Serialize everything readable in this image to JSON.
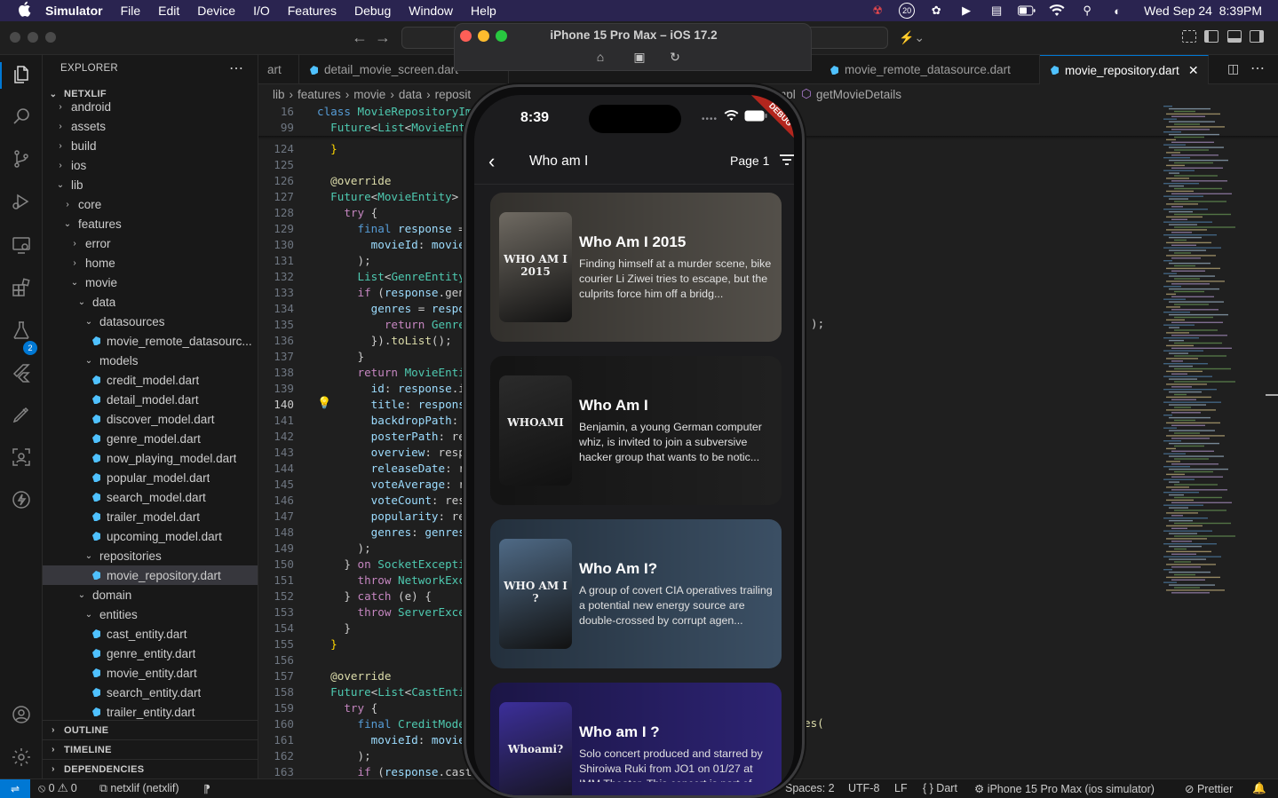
{
  "menubar": {
    "app": "Simulator",
    "items": [
      "File",
      "Edit",
      "Device",
      "I/O",
      "Features",
      "Debug",
      "Window",
      "Help"
    ],
    "status_badge": "20",
    "datetime": "Wed Sep 24  8:39PM"
  },
  "simulator": {
    "title": "iPhone 15 Pro Max – iOS 17.2",
    "time": "8:39",
    "debug_label": "DEBUG",
    "appbar_title": "Who am I",
    "page_label": "Page 1",
    "movies": [
      {
        "title": "Who Am I 2015",
        "overview": "Finding himself at a murder scene, bike courier Li Ziwei tries to escape, but the culprits force him off a bridg...",
        "poster_text": "WHO AM I 2015",
        "accent": "#6f6a62"
      },
      {
        "title": "Who Am I",
        "overview": "Benjamin, a young German computer whiz, is invited to join a subversive hacker group that wants to be notic...",
        "poster_text": "WHOAMI",
        "accent": "#2b2b2b"
      },
      {
        "title": "Who Am I?",
        "overview": "A group of covert CIA operatives trailing a potential new energy source are double-crossed by corrupt agen...",
        "poster_text": "WHO AM I ?",
        "accent": "#4f6a86"
      },
      {
        "title": "Who am I ?",
        "overview": "Solo concert produced and starred by Shiroiwa Ruki from JO1 on 01/27 at IMM Theater. This concert is part of",
        "poster_text": "Whoami?",
        "accent": "#3c2f9a"
      }
    ]
  },
  "explorer": {
    "header": "EXPLORER",
    "root": "NETXLIF",
    "tree": [
      {
        "label": "android",
        "indent": 1,
        "kind": "folder-closed"
      },
      {
        "label": "assets",
        "indent": 1,
        "kind": "folder-closed"
      },
      {
        "label": "build",
        "indent": 1,
        "kind": "folder-closed"
      },
      {
        "label": "ios",
        "indent": 1,
        "kind": "folder-closed"
      },
      {
        "label": "lib",
        "indent": 1,
        "kind": "folder-open"
      },
      {
        "label": "core",
        "indent": 2,
        "kind": "folder-closed"
      },
      {
        "label": "features",
        "indent": 2,
        "kind": "folder-open"
      },
      {
        "label": "error",
        "indent": 3,
        "kind": "folder-closed"
      },
      {
        "label": "home",
        "indent": 3,
        "kind": "folder-closed"
      },
      {
        "label": "movie",
        "indent": 3,
        "kind": "folder-open"
      },
      {
        "label": "data",
        "indent": 4,
        "kind": "folder-open"
      },
      {
        "label": "datasources",
        "indent": 5,
        "kind": "folder-open"
      },
      {
        "label": "movie_remote_datasourc...",
        "indent": 6,
        "kind": "file"
      },
      {
        "label": "models",
        "indent": 5,
        "kind": "folder-open"
      },
      {
        "label": "credit_model.dart",
        "indent": 6,
        "kind": "file"
      },
      {
        "label": "detail_model.dart",
        "indent": 6,
        "kind": "file"
      },
      {
        "label": "discover_model.dart",
        "indent": 6,
        "kind": "file"
      },
      {
        "label": "genre_model.dart",
        "indent": 6,
        "kind": "file"
      },
      {
        "label": "now_playing_model.dart",
        "indent": 6,
        "kind": "file"
      },
      {
        "label": "popular_model.dart",
        "indent": 6,
        "kind": "file"
      },
      {
        "label": "search_model.dart",
        "indent": 6,
        "kind": "file"
      },
      {
        "label": "trailer_model.dart",
        "indent": 6,
        "kind": "file"
      },
      {
        "label": "upcoming_model.dart",
        "indent": 6,
        "kind": "file"
      },
      {
        "label": "repositories",
        "indent": 5,
        "kind": "folder-open"
      },
      {
        "label": "movie_repository.dart",
        "indent": 6,
        "kind": "file",
        "selected": true
      },
      {
        "label": "domain",
        "indent": 4,
        "kind": "folder-open"
      },
      {
        "label": "entities",
        "indent": 5,
        "kind": "folder-open"
      },
      {
        "label": "cast_entity.dart",
        "indent": 6,
        "kind": "file"
      },
      {
        "label": "genre_entity.dart",
        "indent": 6,
        "kind": "file"
      },
      {
        "label": "movie_entity.dart",
        "indent": 6,
        "kind": "file"
      },
      {
        "label": "search_entity.dart",
        "indent": 6,
        "kind": "file"
      },
      {
        "label": "trailer_entity.dart",
        "indent": 6,
        "kind": "file"
      }
    ],
    "sections": [
      "OUTLINE",
      "TIMELINE",
      "DEPENDENCIES"
    ]
  },
  "tabs": [
    {
      "label": "art",
      "icon": false
    },
    {
      "label": "detail_movie_screen.dart",
      "icon": true
    },
    {
      "label": "movie_remote_datasource.dart",
      "icon": true
    },
    {
      "label": "movie_repository.dart",
      "icon": true,
      "active": true
    }
  ],
  "breadcrumb": {
    "left": [
      "lib",
      "features",
      "movie",
      "data",
      "reposit"
    ],
    "right": [
      "mpl",
      "getMovieDetails"
    ]
  },
  "sticky_lines": [
    {
      "n": "16",
      "code": [
        [
          "kw",
          "class "
        ],
        [
          "ty",
          "MovieRepositoryImp"
        ]
      ]
    },
    {
      "n": "99",
      "code": [
        [
          "",
          "  "
        ],
        [
          "ty",
          "Future"
        ],
        [
          "",
          "<"
        ],
        [
          "ty",
          "List"
        ],
        [
          "",
          "<"
        ],
        [
          "ty",
          "MovieEnti"
        ]
      ]
    }
  ],
  "code_lines": [
    {
      "n": "124",
      "code": [
        [
          "",
          "  "
        ],
        [
          "pu",
          "}"
        ]
      ]
    },
    {
      "n": "125",
      "code": []
    },
    {
      "n": "126",
      "code": [
        [
          "",
          "  "
        ],
        [
          "an",
          "@override"
        ]
      ]
    },
    {
      "n": "127",
      "code": [
        [
          "",
          "  "
        ],
        [
          "ty",
          "Future"
        ],
        [
          "",
          "<"
        ],
        [
          "ty",
          "MovieEntity"
        ],
        [
          "",
          "> "
        ],
        [
          "an",
          "g"
        ]
      ]
    },
    {
      "n": "128",
      "code": [
        [
          "",
          "    "
        ],
        [
          "kw2",
          "try"
        ],
        [
          "",
          " {"
        ]
      ]
    },
    {
      "n": "129",
      "code": [
        [
          "",
          "      "
        ],
        [
          "kw",
          "final "
        ],
        [
          "va",
          "response"
        ],
        [
          "",
          " ="
        ]
      ]
    },
    {
      "n": "130",
      "code": [
        [
          "",
          "        "
        ],
        [
          "va",
          "movieId"
        ],
        [
          "",
          ": "
        ],
        [
          "va",
          "movieI"
        ]
      ]
    },
    {
      "n": "131",
      "code": [
        [
          "",
          "      );"
        ]
      ]
    },
    {
      "n": "132",
      "code": [
        [
          "",
          "      "
        ],
        [
          "ty",
          "List"
        ],
        [
          "",
          "<"
        ],
        [
          "ty",
          "GenreEntity"
        ]
      ]
    },
    {
      "n": "133",
      "code": [
        [
          "",
          "      "
        ],
        [
          "kw2",
          "if"
        ],
        [
          "",
          " ("
        ],
        [
          "va",
          "response"
        ],
        [
          "",
          ".gen"
        ]
      ]
    },
    {
      "n": "134",
      "code": [
        [
          "",
          "        "
        ],
        [
          "va",
          "genres"
        ],
        [
          "",
          " = "
        ],
        [
          "va",
          "respo"
        ]
      ]
    },
    {
      "n": "135",
      "code": [
        [
          "",
          "          "
        ],
        [
          "kw2",
          "return "
        ],
        [
          "ty",
          "Genre"
        ]
      ]
    },
    {
      "n": "136",
      "code": [
        [
          "",
          "        })."
        ],
        [
          "an",
          "toList"
        ],
        [
          "",
          "();"
        ]
      ]
    },
    {
      "n": "137",
      "code": [
        [
          "",
          "      }"
        ]
      ]
    },
    {
      "n": "138",
      "code": [
        [
          "",
          "      "
        ],
        [
          "kw2",
          "return "
        ],
        [
          "ty",
          "MovieEntit"
        ]
      ]
    },
    {
      "n": "139",
      "code": [
        [
          "",
          "        "
        ],
        [
          "va",
          "id"
        ],
        [
          "",
          ": "
        ],
        [
          "va",
          "response"
        ],
        [
          "",
          ".i"
        ]
      ]
    },
    {
      "n": "140",
      "code": [
        [
          "",
          "        "
        ],
        [
          "va",
          "title"
        ],
        [
          "",
          ": "
        ],
        [
          "va",
          "response"
        ]
      ],
      "current": true
    },
    {
      "n": "141",
      "code": [
        [
          "",
          "        "
        ],
        [
          "va",
          "backdropPath"
        ],
        [
          "",
          ": r"
        ]
      ]
    },
    {
      "n": "142",
      "code": [
        [
          "",
          "        "
        ],
        [
          "va",
          "posterPath"
        ],
        [
          "",
          ": res"
        ]
      ]
    },
    {
      "n": "143",
      "code": [
        [
          "",
          "        "
        ],
        [
          "va",
          "overview"
        ],
        [
          "",
          ": respo"
        ]
      ]
    },
    {
      "n": "144",
      "code": [
        [
          "",
          "        "
        ],
        [
          "va",
          "releaseDate"
        ],
        [
          "",
          ": re"
        ]
      ]
    },
    {
      "n": "145",
      "code": [
        [
          "",
          "        "
        ],
        [
          "va",
          "voteAverage"
        ],
        [
          "",
          ": re"
        ]
      ]
    },
    {
      "n": "146",
      "code": [
        [
          "",
          "        "
        ],
        [
          "va",
          "voteCount"
        ],
        [
          "",
          ": resp"
        ]
      ]
    },
    {
      "n": "147",
      "code": [
        [
          "",
          "        "
        ],
        [
          "va",
          "popularity"
        ],
        [
          "",
          ": res"
        ]
      ]
    },
    {
      "n": "148",
      "code": [
        [
          "",
          "        "
        ],
        [
          "va",
          "genres"
        ],
        [
          "",
          ": "
        ],
        [
          "va",
          "genres"
        ],
        [
          "",
          ","
        ]
      ]
    },
    {
      "n": "149",
      "code": [
        [
          "",
          "      );"
        ]
      ]
    },
    {
      "n": "150",
      "code": [
        [
          "",
          "    } "
        ],
        [
          "kw2",
          "on "
        ],
        [
          "ty",
          "SocketExceptio"
        ]
      ]
    },
    {
      "n": "151",
      "code": [
        [
          "",
          "      "
        ],
        [
          "kw2",
          "throw "
        ],
        [
          "ty",
          "NetworkExce"
        ]
      ]
    },
    {
      "n": "152",
      "code": [
        [
          "",
          "    } "
        ],
        [
          "kw2",
          "catch"
        ],
        [
          "",
          " (e) {"
        ]
      ]
    },
    {
      "n": "153",
      "code": [
        [
          "",
          "      "
        ],
        [
          "kw2",
          "throw "
        ],
        [
          "ty",
          "ServerExcep"
        ]
      ]
    },
    {
      "n": "154",
      "code": [
        [
          "",
          "    }"
        ]
      ]
    },
    {
      "n": "155",
      "code": [
        [
          "",
          "  "
        ],
        [
          "pu",
          "}"
        ]
      ]
    },
    {
      "n": "156",
      "code": []
    },
    {
      "n": "157",
      "code": [
        [
          "",
          "  "
        ],
        [
          "an",
          "@override"
        ]
      ]
    },
    {
      "n": "158",
      "code": [
        [
          "",
          "  "
        ],
        [
          "ty",
          "Future"
        ],
        [
          "",
          "<"
        ],
        [
          "ty",
          "List"
        ],
        [
          "",
          "<"
        ],
        [
          "ty",
          "CastEntit"
        ]
      ]
    },
    {
      "n": "159",
      "code": [
        [
          "",
          "    "
        ],
        [
          "kw2",
          "try"
        ],
        [
          "",
          " {"
        ]
      ]
    },
    {
      "n": "160",
      "code": [
        [
          "",
          "      "
        ],
        [
          "kw",
          "final "
        ],
        [
          "ty",
          "CreditModel"
        ]
      ]
    },
    {
      "n": "161",
      "code": [
        [
          "",
          "        "
        ],
        [
          "va",
          "movieId"
        ],
        [
          "",
          ": "
        ],
        [
          "va",
          "movieI"
        ]
      ]
    },
    {
      "n": "162",
      "code": [
        [
          "",
          "      );"
        ]
      ]
    },
    {
      "n": "163",
      "code": [
        [
          "",
          "      "
        ],
        [
          "kw2",
          "if"
        ],
        [
          "",
          " ("
        ],
        [
          "va",
          "response"
        ],
        [
          "",
          ".cast"
        ]
      ]
    }
  ],
  "code_overflow": {
    "line136_tail": ");",
    "line160_tail": "es("
  },
  "statusbar": {
    "problems": "0",
    "warnings": "0",
    "branch": "netxlif (netxlif)",
    "spaces": "Spaces: 2",
    "encoding": "UTF-8",
    "eol": "LF",
    "language": "Dart",
    "device": "iPhone 15 Pro Max (ios simulator)",
    "formatter": "Prettier"
  }
}
